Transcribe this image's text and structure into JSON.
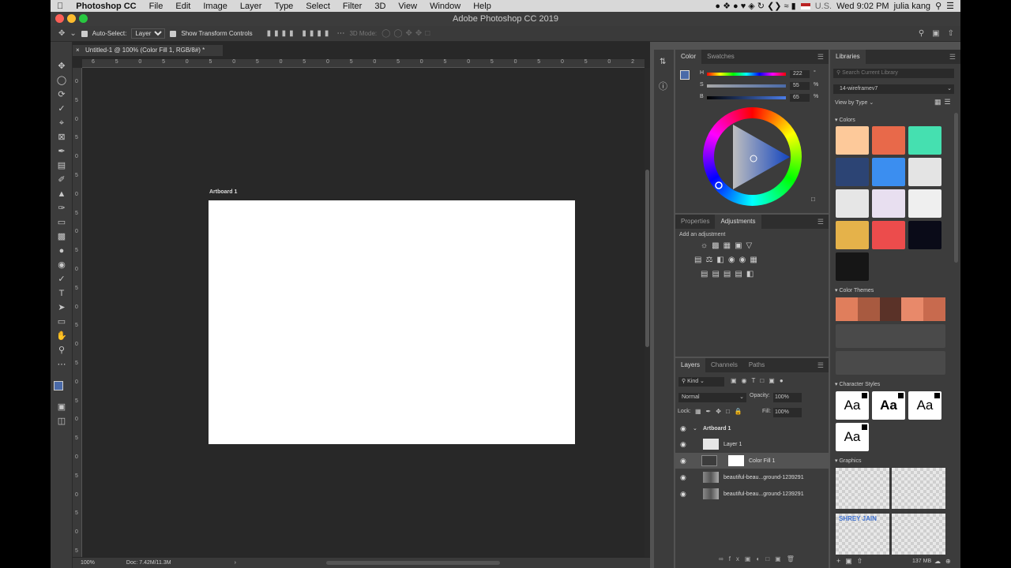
{
  "menubar": {
    "app_name": "Photoshop CC",
    "items": [
      "File",
      "Edit",
      "Image",
      "Layer",
      "Type",
      "Select",
      "Filter",
      "3D",
      "View",
      "Window",
      "Help"
    ],
    "input_source": "U.S.",
    "clock": "Wed 9:02 PM",
    "user": "julia kang"
  },
  "window": {
    "title": "Adobe Photoshop CC 2019"
  },
  "options": {
    "auto_select_label": "Auto-Select:",
    "auto_select_value": "Layer",
    "show_transform_label": "Show Transform Controls",
    "mode_3d_label": "3D Mode:"
  },
  "document": {
    "tab_title": "Untitled-1 @ 100% (Color Fill 1, RGB/8#) *",
    "artboard_label": "Artboard 1",
    "zoom": "100%",
    "doc_size": "Doc: 7.42M/11.3M",
    "ruler_h": [
      "6",
      "5",
      "0",
      "5",
      "0",
      "5",
      "0",
      "5",
      "0",
      "5",
      "0",
      "5",
      "0",
      "5",
      "0",
      "5",
      "0",
      "5",
      "0",
      "5",
      "0",
      "5",
      "0",
      "2"
    ],
    "ruler_v": [
      "0",
      "5",
      "0",
      "5",
      "0",
      "5",
      "0",
      "5",
      "0",
      "5",
      "0",
      "5",
      "0",
      "5",
      "0",
      "5",
      "0",
      "5",
      "0",
      "5",
      "0",
      "5",
      "0",
      "5",
      "0",
      "5"
    ]
  },
  "color_panel": {
    "tabs": [
      "Color",
      "Swatches"
    ],
    "h_label": "H",
    "h_value": "222",
    "h_unit": "°",
    "s_label": "S",
    "s_value": "55",
    "s_unit": "%",
    "b_label": "B",
    "b_value": "65",
    "b_unit": "%",
    "foreground": "#4a6aa8"
  },
  "adjustments_panel": {
    "tabs": [
      "Properties",
      "Adjustments"
    ],
    "hint": "Add an adjustment"
  },
  "layers_panel": {
    "tabs": [
      "Layers",
      "Channels",
      "Paths"
    ],
    "filter_label": "Kind",
    "blend_mode": "Normal",
    "opacity_label": "Opacity:",
    "opacity_value": "100%",
    "lock_label": "Lock:",
    "fill_label": "Fill:",
    "fill_value": "100%",
    "layers": [
      {
        "name": "Artboard 1"
      },
      {
        "name": "Layer 1"
      },
      {
        "name": "Color Fill 1"
      },
      {
        "name": "beautiful-beau...ground-1239291"
      },
      {
        "name": "beautiful-beau...ground-1239291"
      }
    ]
  },
  "libraries": {
    "tab": "Libraries",
    "search_placeholder": "Search Current Library",
    "library_name": "14-wireframev7",
    "view_by": "View by Type",
    "colors_label": "Colors",
    "colors": [
      "#fdc99a",
      "#e8694a",
      "#45e0b0",
      "#2c4474",
      "#3b8ef0",
      "#e4e4e4",
      "#e6e6e6",
      "#e8dff0",
      "#efefef",
      "#e5b24a",
      "#ec4c4c",
      "#0a0b18",
      "#161616"
    ],
    "themes_label": "Color Themes",
    "theme_colors": [
      "#e07e5c",
      "#a85a40",
      "#5a3228",
      "#e8896a",
      "#c86a4e"
    ],
    "char_styles_label": "Character Styles",
    "char_style_sample": "Aa",
    "graphics_label": "Graphics",
    "graphic_caption": "SHREY JAIN",
    "storage": "137 MB"
  }
}
